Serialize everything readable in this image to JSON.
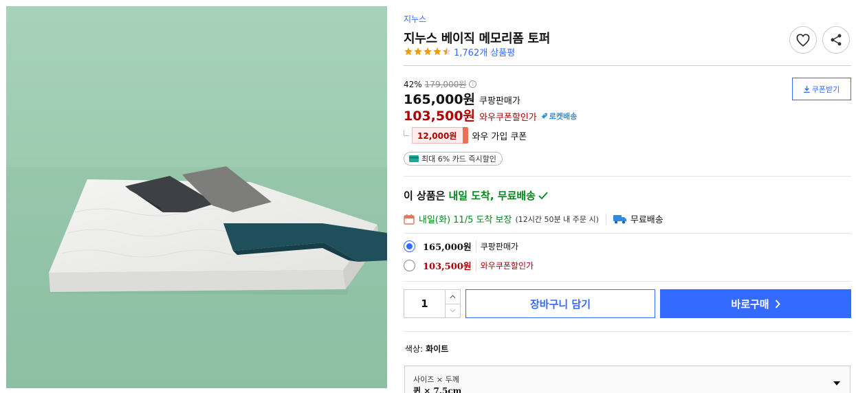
{
  "product": {
    "brand": "지누스",
    "title": "지누스 베이직 메모리폼 토퍼",
    "rating_stars": 4.5,
    "review_count": "1,762개 상품평"
  },
  "actions": {
    "wishlist_icon": "heart-icon",
    "share_icon": "share-icon",
    "coupon_button": "쿠폰받기"
  },
  "pricing": {
    "discount_rate": "42%",
    "original_price": "179,000원",
    "sale_price": "165,000원",
    "sale_label": "쿠팡판매가",
    "wow_price": "103,500원",
    "wow_label": "와우쿠폰할인가",
    "rocket_badge": "로켓배송"
  },
  "coupon": {
    "amount": "12,000원",
    "description": "와우 가입 쿠폰"
  },
  "card_discount": "최대 6% 카드 즉시할인",
  "delivery": {
    "headline_prefix": "이 상품은",
    "headline_highlight": "내일 도착, 무료배송",
    "arrival": "내일(화) 11/5 도착 보장",
    "condition": "(12시간 50분 내 주문 시)",
    "free_shipping": "무료배송"
  },
  "purchase_options": [
    {
      "amount": "165,000원",
      "label": "쿠팡판매가",
      "selected": true
    },
    {
      "amount": "103,500원",
      "label": "와우쿠폰할인가",
      "selected": false
    }
  ],
  "quantity": "1",
  "buttons": {
    "cart": "장바구니 담기",
    "buy": "바로구매"
  },
  "color": {
    "label": "색상:",
    "value": "화이트"
  },
  "size_option": {
    "label": "사이즈 × 두께",
    "value": "퀸 × 7.5cm"
  },
  "colors": {
    "accent": "#346aff",
    "price_red": "#ae0000",
    "delivery_green": "#00891a",
    "star": "#f49b00",
    "photo_bg": "#a3cfb6"
  }
}
